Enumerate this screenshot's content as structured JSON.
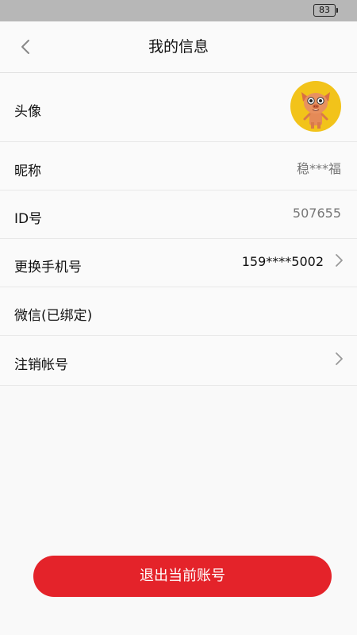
{
  "status_bar": {
    "battery": "83"
  },
  "header": {
    "title": "我的信息"
  },
  "rows": [
    {
      "label": "头像"
    },
    {
      "label": "昵称",
      "value": "稳***福"
    },
    {
      "label": "ID号",
      "value": "507655"
    },
    {
      "label": "更换手机号",
      "value": "159****5002"
    },
    {
      "label": "微信(已绑定)"
    },
    {
      "label": "注销帐号"
    }
  ],
  "logout_button": {
    "label": "退出当前账号"
  },
  "colors": {
    "accent": "#e4232a",
    "status_bar": "#b7b7b7",
    "avatar_bg": "#f2c31a"
  },
  "icons": [
    "back-chevron-icon",
    "battery-icon",
    "chevron-right-icon",
    "avatar-cartoon-pig"
  ]
}
